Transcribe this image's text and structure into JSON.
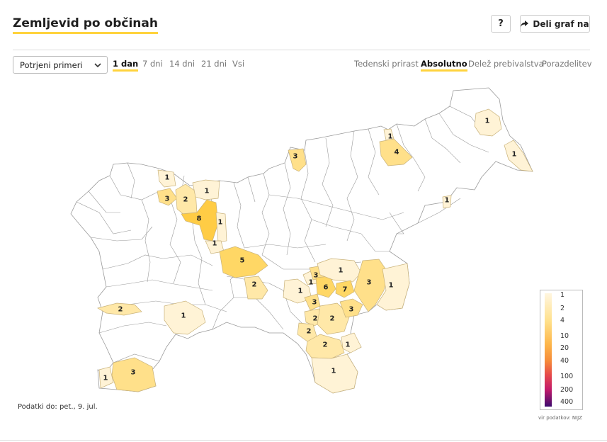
{
  "header": {
    "title": "Zemljevid po občinah",
    "help_label": "?",
    "share_label": "Deli graf na"
  },
  "controls": {
    "select_value": "Potrjeni primeri",
    "periods": [
      "1 dan",
      "7 dni",
      "14 dni",
      "21 dni",
      "Vsi"
    ],
    "active_period": "1 dan",
    "modes": [
      "Tedenski prirast",
      "Absolutno",
      "Delež prebivalstva",
      "Porazdelitev"
    ],
    "active_mode": "Absolutno"
  },
  "map": {
    "municipality_values": [
      {
        "value": 1
      },
      {
        "value": 1
      },
      {
        "value": 1
      },
      {
        "value": 4
      },
      {
        "value": 3
      },
      {
        "value": 1
      },
      {
        "value": 1
      },
      {
        "value": 3
      },
      {
        "value": 2
      },
      {
        "value": 1
      },
      {
        "value": 8
      },
      {
        "value": 1
      },
      {
        "value": 1
      },
      {
        "value": 5
      },
      {
        "value": 2
      },
      {
        "value": 1
      },
      {
        "value": 1
      },
      {
        "value": 3
      },
      {
        "value": 6
      },
      {
        "value": 1
      },
      {
        "value": 7
      },
      {
        "value": 3
      },
      {
        "value": 1
      },
      {
        "value": 3
      },
      {
        "value": 2
      },
      {
        "value": 2
      },
      {
        "value": 3
      },
      {
        "value": 2
      },
      {
        "value": 1
      },
      {
        "value": 2
      },
      {
        "value": 1
      },
      {
        "value": 2
      },
      {
        "value": 1
      },
      {
        "value": 1
      },
      {
        "value": 3
      }
    ],
    "colors": {
      "outline": "#9a9a9a",
      "empty": "#ffffff",
      "v1": "#fff3d6",
      "v2": "#ffe8a8",
      "v3": "#ffe08a",
      "v5": "#ffd765",
      "v8": "#ffcc45"
    }
  },
  "legend": {
    "ticks": [
      "1",
      "2",
      "4",
      "10",
      "20",
      "40",
      "100",
      "200",
      "400"
    ],
    "source": "vir podatkov: NIJZ"
  },
  "footer": {
    "data_date": "Podatki do: pet., 9. jul."
  }
}
